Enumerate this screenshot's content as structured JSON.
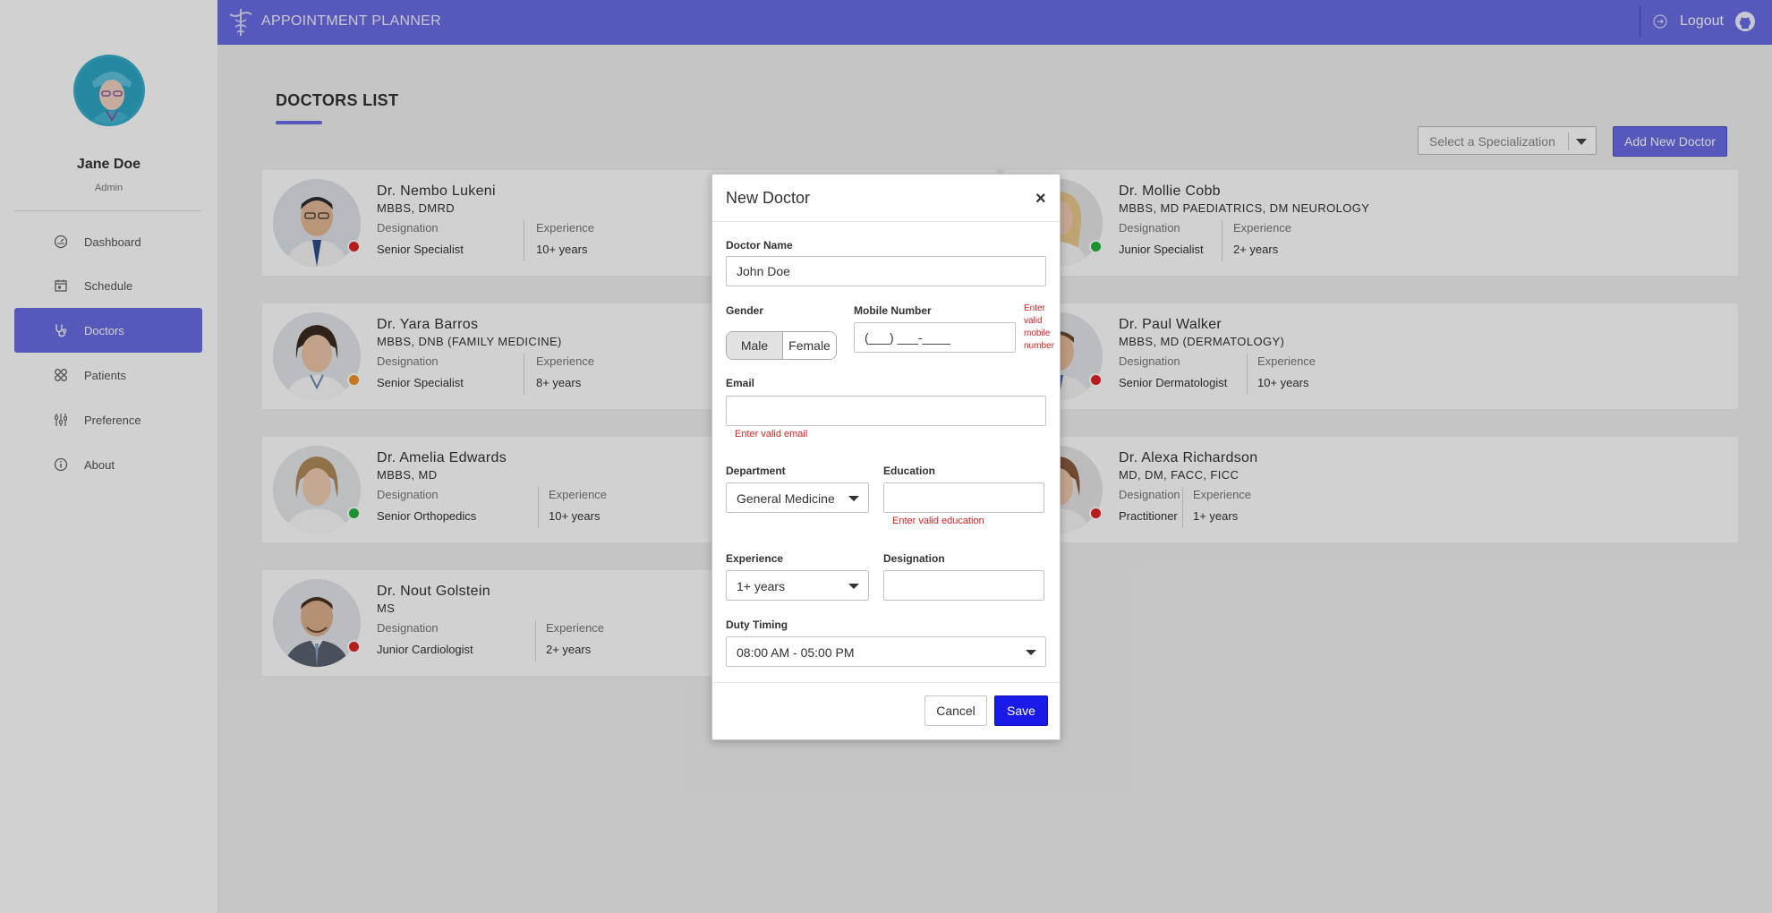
{
  "app": {
    "title": "APPOINTMENT PLANNER",
    "logout_label": "Logout"
  },
  "user": {
    "name": "Jane Doe",
    "role": "Admin"
  },
  "sidebar": {
    "items": [
      {
        "label": "Dashboard",
        "icon": "dashboard-icon",
        "active": false
      },
      {
        "label": "Schedule",
        "icon": "calendar-icon",
        "active": false
      },
      {
        "label": "Doctors",
        "icon": "stethoscope-icon",
        "active": true
      },
      {
        "label": "Patients",
        "icon": "patients-icon",
        "active": false
      },
      {
        "label": "Preference",
        "icon": "sliders-icon",
        "active": false
      },
      {
        "label": "About",
        "icon": "info-icon",
        "active": false
      }
    ]
  },
  "page": {
    "title": "DOCTORS LIST",
    "specialization_placeholder": "Select a Specialization",
    "add_button": "Add New Doctor",
    "designation_label": "Designation",
    "experience_label": "Experience"
  },
  "doctors": [
    {
      "name": "Dr. Nembo Lukeni",
      "qualification": "MBBS, DMRD",
      "designation": "Senior Specialist",
      "experience": "10+ years",
      "status_color": "#e02424"
    },
    {
      "name": "Dr. Mollie Cobb",
      "qualification": "MBBS, MD PAEDIATRICS, DM NEUROLOGY",
      "designation": "Junior Specialist",
      "experience": "2+ years",
      "status_color": "#1fb23a"
    },
    {
      "name": "Dr. Yara Barros",
      "qualification": "MBBS, DNB (FAMILY MEDICINE)",
      "designation": "Senior Specialist",
      "experience": "8+ years",
      "status_color": "#f29325"
    },
    {
      "name": "Dr. Paul Walker",
      "qualification": "MBBS, MD (DERMATOLOGY)",
      "designation": "Senior Dermatologist",
      "experience": "10+ years",
      "status_color": "#e02424"
    },
    {
      "name": "Dr. Amelia Edwards",
      "qualification": "MBBS, MD",
      "designation": "Senior Orthopedics",
      "experience": "10+ years",
      "status_color": "#1fb23a"
    },
    {
      "name": "Dr. Alexa Richardson",
      "qualification": "MD, DM, FACC, FICC",
      "designation": "Practitioner",
      "experience": "1+ years",
      "status_color": "#e02424"
    },
    {
      "name": "Dr. Nout Golstein",
      "qualification": "MS",
      "designation": "Junior Cardiologist",
      "experience": "2+ years",
      "status_color": "#e02424"
    }
  ],
  "modal": {
    "title": "New Doctor",
    "close_glyph": "×",
    "doctor_name_label": "Doctor Name",
    "doctor_name_value": "John Doe",
    "gender_label": "Gender",
    "gender_male": "Male",
    "gender_female": "Female",
    "gender_selected": "Male",
    "mobile_label": "Mobile Number",
    "mobile_value": "(___) ___-____",
    "mobile_error": "Enter valid mobile number",
    "email_label": "Email",
    "email_value": "",
    "email_error": "Enter valid email",
    "department_label": "Department",
    "department_value": "General Medicine",
    "education_label": "Education",
    "education_value": "",
    "education_error": "Enter valid education",
    "experience_label": "Experience",
    "experience_value": "1+ years",
    "designation_label": "Designation",
    "designation_value": "",
    "duty_label": "Duty Timing",
    "duty_value": "08:00 AM - 05:00 PM",
    "cancel_label": "Cancel",
    "save_label": "Save"
  },
  "colors": {
    "accent": "#6a6ce6",
    "save_button": "#1a1ae8",
    "error": "#d62222"
  }
}
